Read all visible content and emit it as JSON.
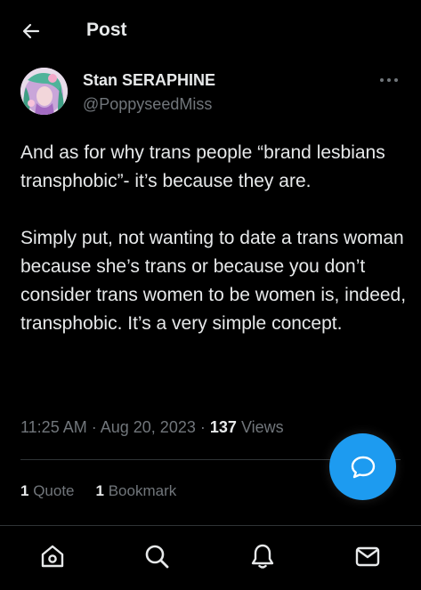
{
  "header": {
    "title": "Post",
    "back_icon": "arrow-left-icon"
  },
  "author": {
    "display_name": "Stan SERAPHINE",
    "handle": "@PoppyseedMiss",
    "avatar_icon": "avatar"
  },
  "tweet": {
    "paragraphs": [
      "And as for why trans people “brand lesbians transphobic”- it’s because they are.",
      "Simply put, not wanting to date a trans woman because she’s trans or because you don’t consider trans women to be women is, indeed, transphobic. It’s a very simple concept."
    ],
    "time": "11:25 AM",
    "separator": "·",
    "date": "Aug 20, 2023",
    "views_count": "137",
    "views_label": "Views"
  },
  "stats": {
    "quotes_count": "1",
    "quotes_label": "Quote",
    "bookmarks_count": "1",
    "bookmarks_label": "Bookmark"
  },
  "fab": {
    "icon": "new-post-bubble-icon"
  },
  "bottom_nav": {
    "items": [
      {
        "icon": "home-icon"
      },
      {
        "icon": "search-icon"
      },
      {
        "icon": "bell-icon"
      },
      {
        "icon": "mail-icon"
      }
    ]
  },
  "colors": {
    "background": "#000000",
    "text_primary": "#e7e9ea",
    "text_secondary": "#71767b",
    "accent": "#1d9bf0",
    "divider": "#2f3336"
  }
}
